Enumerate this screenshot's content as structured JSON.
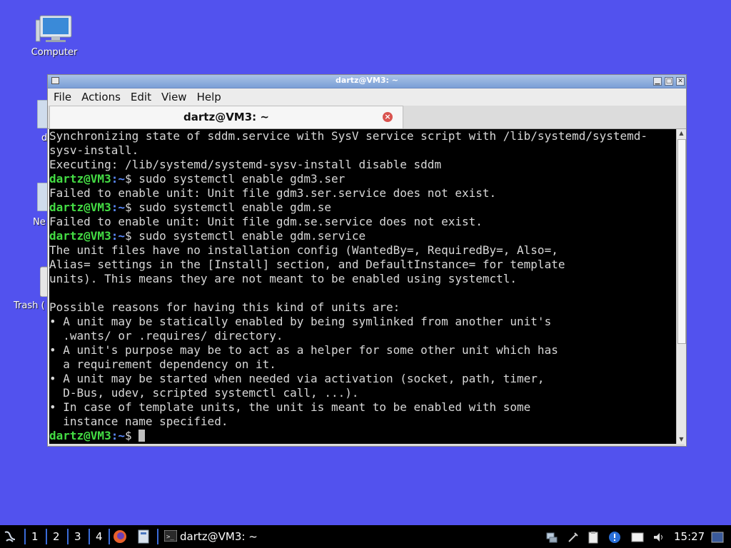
{
  "desktop": {
    "icons": [
      {
        "label": "Computer",
        "icon": "computer-icon"
      }
    ],
    "partial_labels": [
      "d",
      "Ne",
      "Trash ("
    ]
  },
  "window": {
    "title": "dartz@VM3: ~",
    "menu": [
      "File",
      "Actions",
      "Edit",
      "View",
      "Help"
    ],
    "tab_title": "dartz@VM3: ~",
    "terminal": {
      "prompt_user": "dartz@VM3",
      "prompt_path": ":~",
      "lines": [
        {
          "type": "out",
          "text": "Synchronizing state of sddm.service with SysV service script with /lib/systemd/systemd-"
        },
        {
          "type": "out",
          "text": "sysv-install."
        },
        {
          "type": "out",
          "text": "Executing: /lib/systemd/systemd-sysv-install disable sddm"
        },
        {
          "type": "cmd",
          "text": "$ sudo systemctl enable gdm3.ser"
        },
        {
          "type": "out",
          "text": "Failed to enable unit: Unit file gdm3.ser.service does not exist."
        },
        {
          "type": "cmd",
          "text": "$ sudo systemctl enable gdm.se"
        },
        {
          "type": "out",
          "text": "Failed to enable unit: Unit file gdm.se.service does not exist."
        },
        {
          "type": "cmd",
          "text": "$ sudo systemctl enable gdm.service"
        },
        {
          "type": "out",
          "text": "The unit files have no installation config (WantedBy=, RequiredBy=, Also=,"
        },
        {
          "type": "out",
          "text": "Alias= settings in the [Install] section, and DefaultInstance= for template"
        },
        {
          "type": "out",
          "text": "units). This means they are not meant to be enabled using systemctl."
        },
        {
          "type": "out",
          "text": ""
        },
        {
          "type": "out",
          "text": "Possible reasons for having this kind of units are:"
        },
        {
          "type": "out",
          "text": "• A unit may be statically enabled by being symlinked from another unit's"
        },
        {
          "type": "out",
          "text": "  .wants/ or .requires/ directory."
        },
        {
          "type": "out",
          "text": "• A unit's purpose may be to act as a helper for some other unit which has"
        },
        {
          "type": "out",
          "text": "  a requirement dependency on it."
        },
        {
          "type": "out",
          "text": "• A unit may be started when needed via activation (socket, path, timer,"
        },
        {
          "type": "out",
          "text": "  D-Bus, udev, scripted systemctl call, ...)."
        },
        {
          "type": "out",
          "text": "• In case of template units, the unit is meant to be enabled with some"
        },
        {
          "type": "out",
          "text": "  instance name specified."
        },
        {
          "type": "cmd",
          "text": "$ ",
          "cursor": true
        }
      ]
    }
  },
  "taskbar": {
    "workspaces": [
      "1",
      "2",
      "3",
      "4"
    ],
    "task_label": "dartz@VM3: ~",
    "clock": "15:27"
  },
  "colors": {
    "desktop": "#5252ee",
    "prompt_user": "#44dd44",
    "prompt_path": "#5c8cff"
  }
}
